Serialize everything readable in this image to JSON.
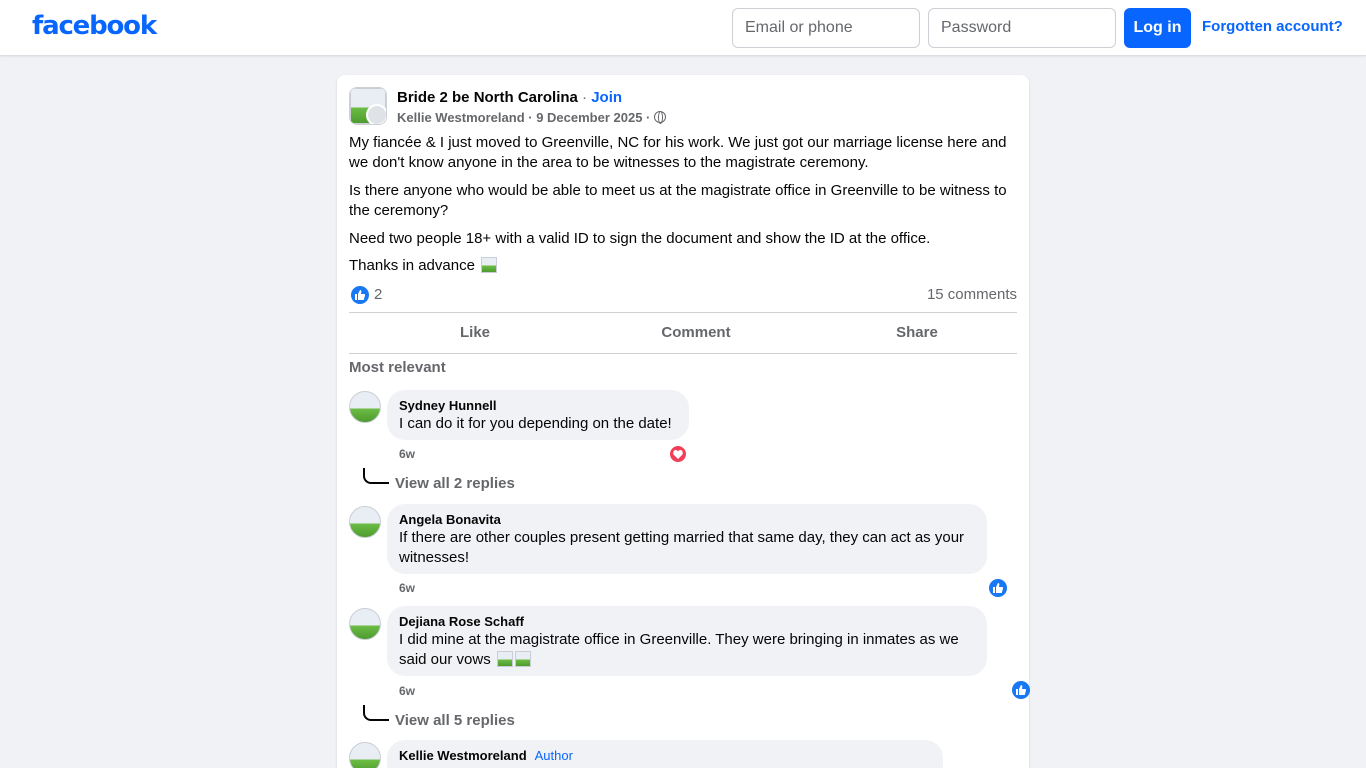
{
  "header": {
    "logo": "facebook",
    "email_placeholder": "Email or phone",
    "password_placeholder": "Password",
    "login_label": "Log in",
    "forgot_label": "Forgotten account?"
  },
  "post": {
    "group_name": "Bride 2 be North Carolina",
    "separator": " · ",
    "join_label": "Join",
    "author": "Kellie Westmoreland",
    "date_text": " · 9 December 2025 · ",
    "paragraphs": [
      "My fiancée & I just moved to Greenville, NC for his work. We just got our marriage license here and we don't know anyone in the area to be witnesses to the magistrate ceremony.",
      "Is there anyone who would be able to meet us at the magistrate office in Greenville to be witness to the ceremony?",
      "Need two people 18+ with a valid ID to sign the document and show the ID at the office.",
      "Thanks in advance"
    ],
    "reaction_count": "2",
    "comments_count": "15 comments",
    "actions": [
      "Like",
      "Comment",
      "Share"
    ],
    "sort_label": "Most relevant"
  },
  "comments": [
    {
      "name": "Sydney Hunnell",
      "text": "I can do it for you depending on the date!",
      "time": "6w",
      "reaction": "heart-icon",
      "replies_label": "View all 2 replies"
    },
    {
      "name": "Angela Bonavita",
      "text": "If there are other couples present getting married that same day, they can act as your witnesses!",
      "time": "6w",
      "reaction": "like-icon"
    },
    {
      "name": "Dejiana Rose Schaff",
      "text": "I did mine at the magistrate office in Greenville. They were bringing in inmates as we said our vows",
      "time": "6w",
      "reaction": "like-icon",
      "replies_label": "View all 5 replies"
    },
    {
      "name": "Kellie Westmoreland",
      "badge": "Author"
    }
  ],
  "colors": {
    "brand": "#0866ff",
    "like": "#1877f2",
    "heart": "#f33e58"
  }
}
